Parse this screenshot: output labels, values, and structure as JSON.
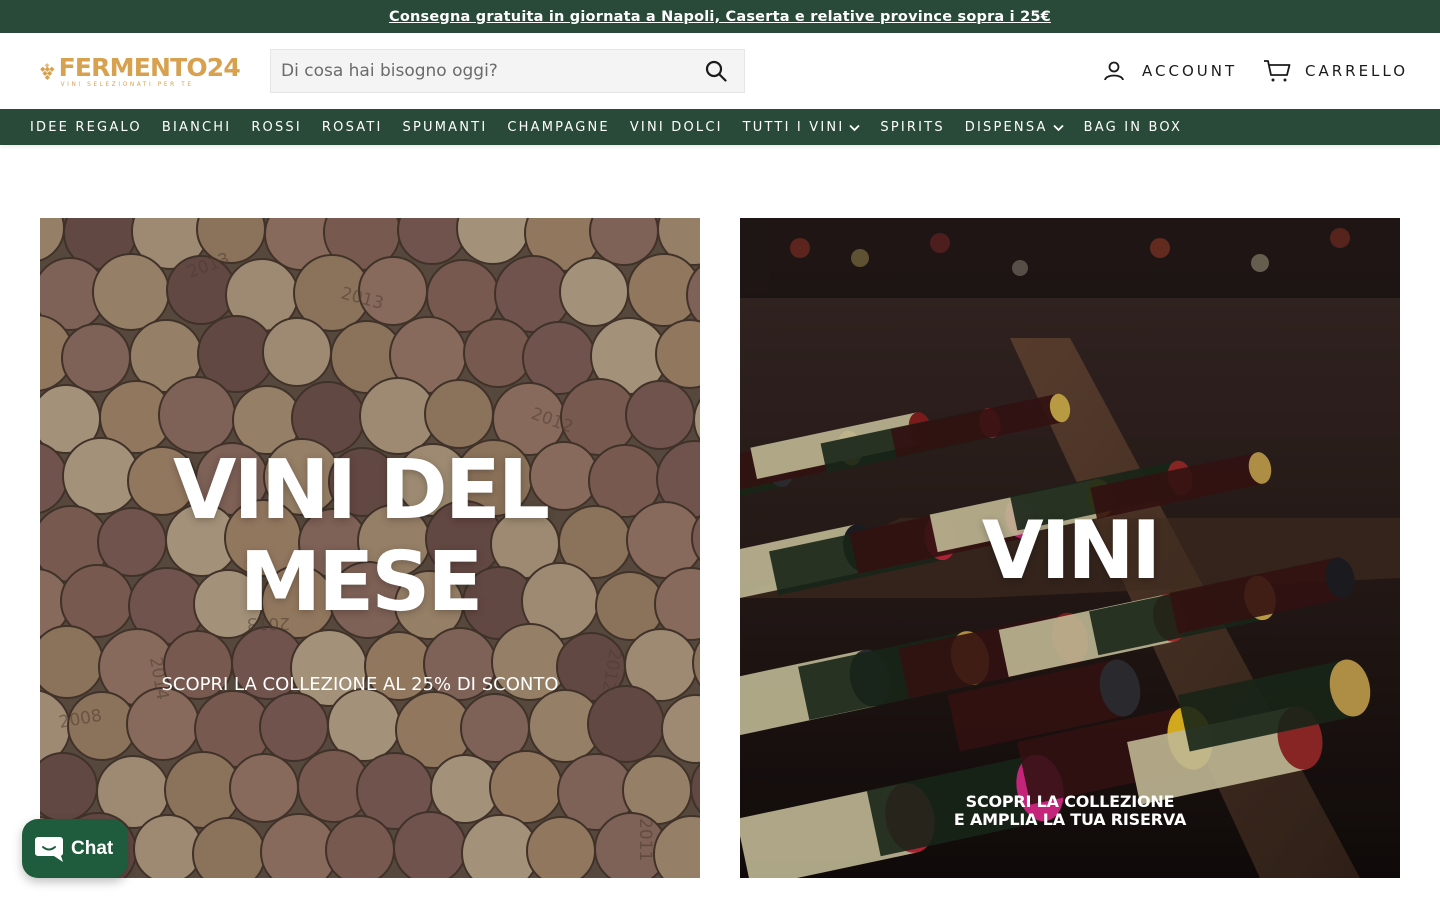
{
  "announcement": {
    "text": "Consegna gratuita in giornata a Napoli, Caserta e relative province sopra i 25€"
  },
  "brand": {
    "name": "FERMENTO24",
    "tagline": "VINI SELEZIONATI PER TE",
    "logo_color": "#d7a14f",
    "primary_color": "#294a38"
  },
  "search": {
    "placeholder": "Di cosa hai bisogno oggi?",
    "value": "",
    "icon": "search-icon"
  },
  "header": {
    "account_label": "ACCOUNT",
    "account_icon": "user-icon",
    "cart_label": "CARRELLO",
    "cart_icon": "cart-icon"
  },
  "nav": {
    "items": [
      {
        "label": "IDEE REGALO",
        "has_dropdown": false
      },
      {
        "label": "BIANCHI",
        "has_dropdown": false
      },
      {
        "label": "ROSSI",
        "has_dropdown": false
      },
      {
        "label": "ROSATI",
        "has_dropdown": false
      },
      {
        "label": "SPUMANTI",
        "has_dropdown": false
      },
      {
        "label": "CHAMPAGNE",
        "has_dropdown": false
      },
      {
        "label": "VINI DOLCI",
        "has_dropdown": false
      },
      {
        "label": "TUTTI I VINI",
        "has_dropdown": true
      },
      {
        "label": "SPIRITS",
        "has_dropdown": false
      },
      {
        "label": "DISPENSA",
        "has_dropdown": true
      },
      {
        "label": "BAG IN BOX",
        "has_dropdown": false
      }
    ]
  },
  "promo_tiles": [
    {
      "title_line1": "VINI DEL",
      "title_line2": "MESE",
      "subtitle": "SCOPRI LA COLLEZIONE AL 25% DI SCONTO",
      "image": "wine-corks-photo",
      "cork_years": [
        "2013",
        "2013",
        "2012",
        "2013",
        "2012",
        "2008",
        "2014",
        "2011"
      ]
    },
    {
      "title_line1": "VINI",
      "subtitle_line1": "SCOPRI LA COLLEZIONE",
      "subtitle_line2": "E AMPLIA LA TUA RISERVA",
      "image": "wine-bottles-rack-photo"
    }
  ],
  "chat_widget": {
    "label": "Chat",
    "icon": "chat-bubble-icon",
    "color": "#1f5b3d"
  }
}
